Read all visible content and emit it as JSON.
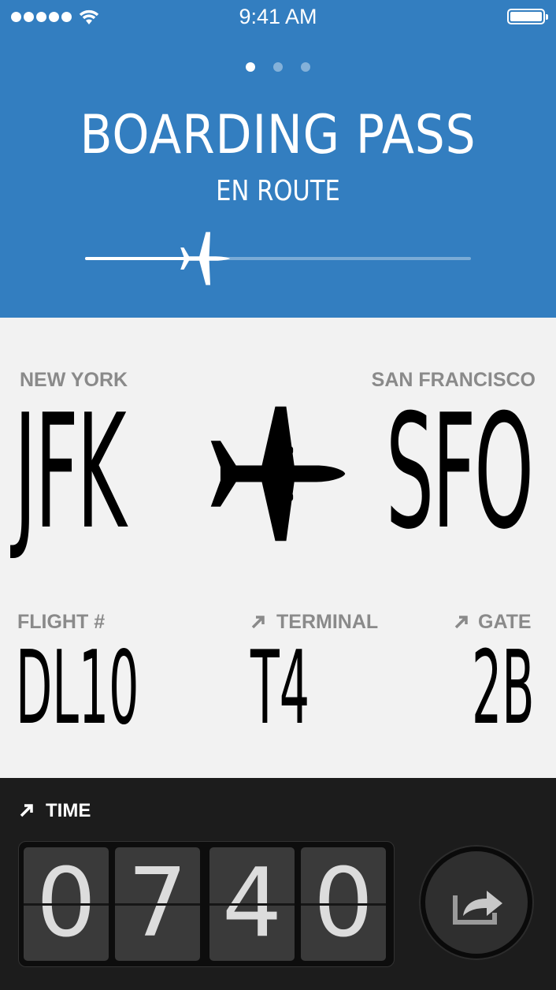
{
  "status_bar": {
    "time": "9:41 AM"
  },
  "header": {
    "title": "BOARDING PASS",
    "subtitle": "EN ROUTE",
    "page_count": 3,
    "active_page": 1,
    "flight_progress_percent": 33,
    "background_color": "#337ec0"
  },
  "route": {
    "origin": {
      "city": "NEW YORK",
      "code": "JFK"
    },
    "destination": {
      "city": "SAN FRANCISCO",
      "code": "SFO"
    }
  },
  "details": {
    "flight": {
      "label": "FLIGHT #",
      "value": "DL10"
    },
    "terminal": {
      "label": "TERMINAL",
      "value": "T4"
    },
    "gate": {
      "label": "GATE",
      "value": "2B"
    }
  },
  "time": {
    "label": "TIME",
    "digits": [
      "0",
      "7",
      "4",
      "0"
    ]
  }
}
